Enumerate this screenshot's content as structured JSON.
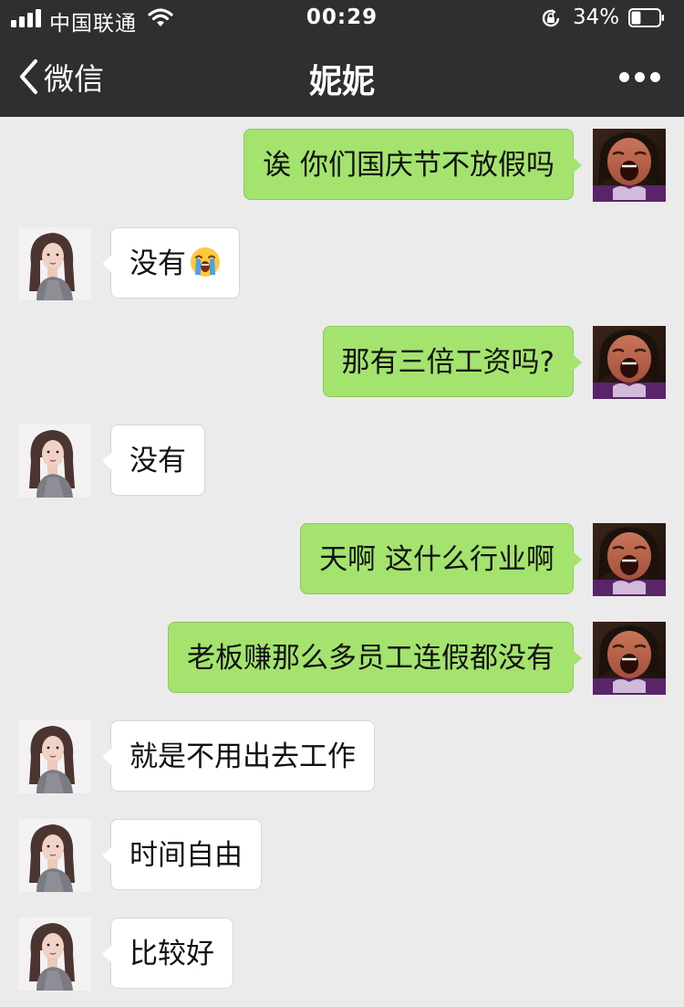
{
  "status_bar": {
    "carrier": "中国联通",
    "time": "00:29",
    "battery": "34%",
    "battery_level": 0.34
  },
  "nav": {
    "back_label": "微信",
    "title": "妮妮"
  },
  "colors": {
    "header_bg": "#2f2f31",
    "chat_bg": "#ebebeb",
    "outgoing_bubble": "#a4e46e",
    "incoming_bubble": "#ffffff"
  },
  "messages": [
    {
      "direction": "outgoing",
      "text": "诶 你们国庆节不放假吗"
    },
    {
      "direction": "incoming",
      "text": "没有",
      "emoji": "loudly-crying-face"
    },
    {
      "direction": "outgoing",
      "text": "那有三倍工资吗?"
    },
    {
      "direction": "incoming",
      "text": "没有"
    },
    {
      "direction": "outgoing",
      "text": "天啊 这什么行业啊"
    },
    {
      "direction": "outgoing",
      "text": "老板赚那么多员工连假都没有"
    },
    {
      "direction": "incoming",
      "text": "就是不用出去工作"
    },
    {
      "direction": "incoming",
      "text": "时间自由"
    },
    {
      "direction": "incoming",
      "text": "比较好"
    }
  ]
}
